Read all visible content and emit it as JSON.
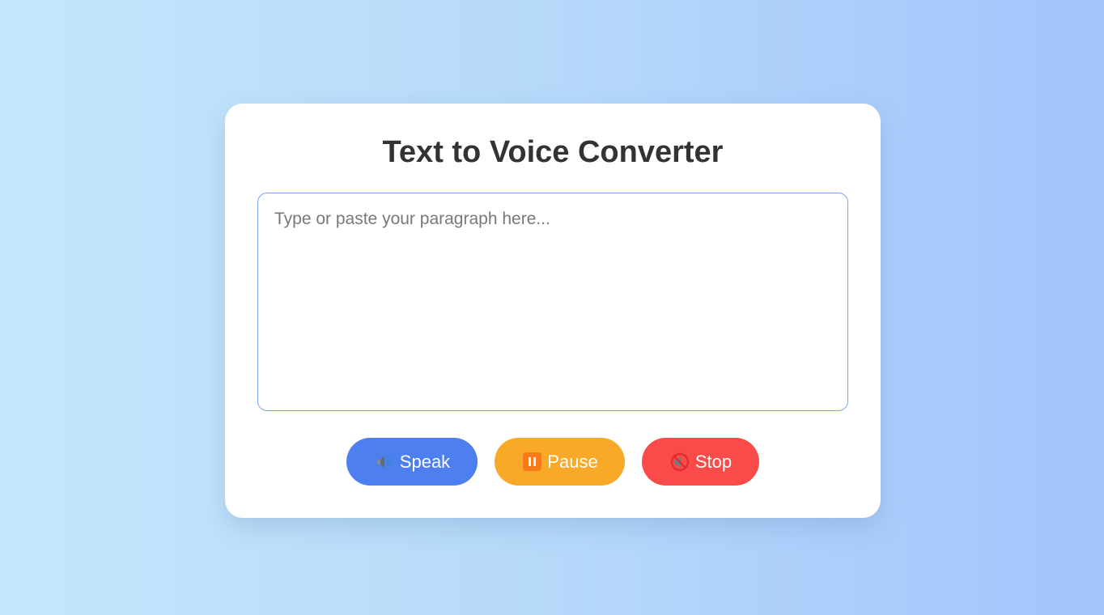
{
  "app": {
    "title": "Text to Voice Converter"
  },
  "editor": {
    "placeholder": "Type or paste your paragraph here...",
    "value": ""
  },
  "buttons": {
    "speak": {
      "label": "Speak",
      "icon": "speaker-icon",
      "color": "#4e7fee"
    },
    "pause": {
      "label": "Pause",
      "icon": "pause-icon",
      "color": "#f8a927"
    },
    "stop": {
      "label": "Stop",
      "icon": "muted-speaker-icon",
      "color": "#fa4b4b"
    }
  },
  "theme": {
    "background_gradient": [
      "#c4e7fb",
      "#a2c4fc"
    ],
    "card_background": "#ffffff",
    "title_color": "#333333"
  }
}
